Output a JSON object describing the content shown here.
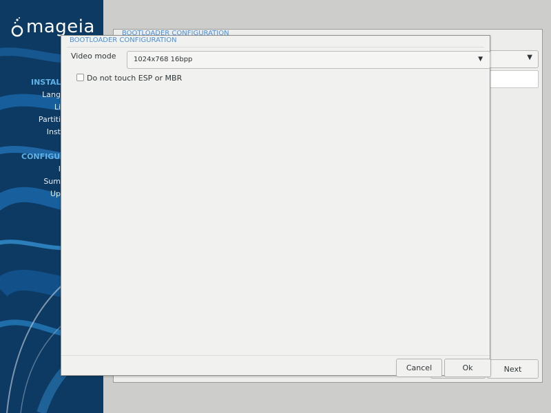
{
  "sidebar": {
    "logo_text": "mageia",
    "heading_install": "INSTALL",
    "heading_config": "CONFIGUR",
    "items": [
      "Lang",
      "Li",
      "Partiti",
      "Inst",
      "I",
      "Sum",
      "Up"
    ]
  },
  "background_window": {
    "title": "BOOTLOADER CONFIGURATION",
    "next_label": "Next"
  },
  "dialog": {
    "title": "BOOTLOADER CONFIGURATION",
    "video_mode_label": "Video mode",
    "video_mode_value": "1024x768 16bpp",
    "esp_checkbox_label": "Do not touch ESP or MBR",
    "esp_checked": false,
    "cancel_label": "Cancel",
    "ok_label": "Ok"
  },
  "colors": {
    "accent": "#4a90d9",
    "sidebar": "#0d3a63",
    "sidebar_heading": "#5fb3e8"
  },
  "icons": {
    "combo_arrow": "chevron-down-icon",
    "logo": "mageia-logo-icon"
  }
}
